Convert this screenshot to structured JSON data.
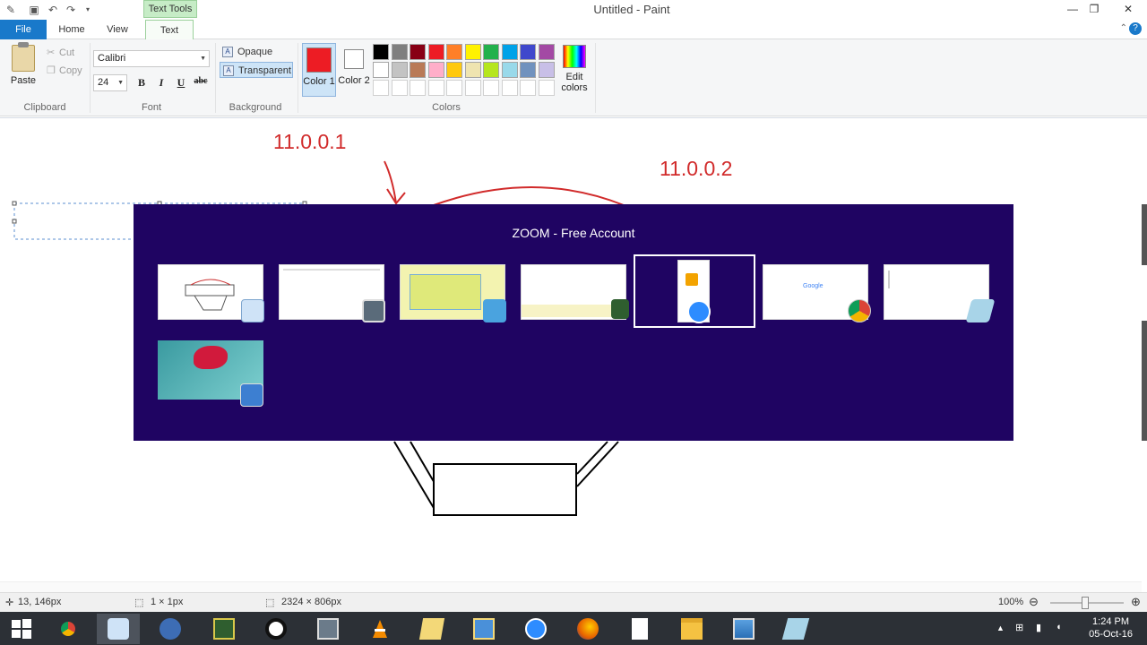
{
  "window": {
    "title": "Untitled - Paint",
    "contextual_tab": "Text Tools",
    "minimize": "—",
    "restore": "❐",
    "close": "✕"
  },
  "tabs": [
    "File",
    "Home",
    "View",
    "Text"
  ],
  "ribbon": {
    "clipboard": {
      "paste": "Paste",
      "cut": "Cut",
      "copy": "Copy",
      "label": "Clipboard"
    },
    "font": {
      "name": "Calibri",
      "size": "24",
      "bold": "B",
      "italic": "I",
      "underline": "U",
      "strikethrough": "abc",
      "label": "Font"
    },
    "background": {
      "opaque": "Opaque",
      "transparent": "Transparent",
      "label": "Background"
    },
    "colors": {
      "color1_label": "Color 1",
      "color2_label": "Color 2",
      "color1": "#ed1c24",
      "color2": "#ffffff",
      "edit_colors": "Edit colors",
      "label": "Colors",
      "palette_row1": [
        "#000000",
        "#7f7f7f",
        "#880015",
        "#ed1c24",
        "#ff7f27",
        "#fff200",
        "#22b14c",
        "#00a2e8",
        "#3f48cc",
        "#a349a4"
      ],
      "palette_row2": [
        "#ffffff",
        "#c3c3c3",
        "#b97a57",
        "#ffaec9",
        "#ffc90e",
        "#efe4b0",
        "#b5e61d",
        "#99d9ea",
        "#7092be",
        "#c8bfe7"
      ]
    }
  },
  "canvas": {
    "label_ip1": "11.0.0.1",
    "label_ip2": "11.0.0.2"
  },
  "zoom_overlay": {
    "title": "ZOOM - Free Account"
  },
  "statusbar": {
    "cursor_pos": "13, 146px",
    "selection_size": "1 × 1px",
    "image_size": "2324 × 806px",
    "zoom": "100%"
  },
  "taskbar": {
    "time": "1:24 PM",
    "date": "05-Oct-16"
  }
}
